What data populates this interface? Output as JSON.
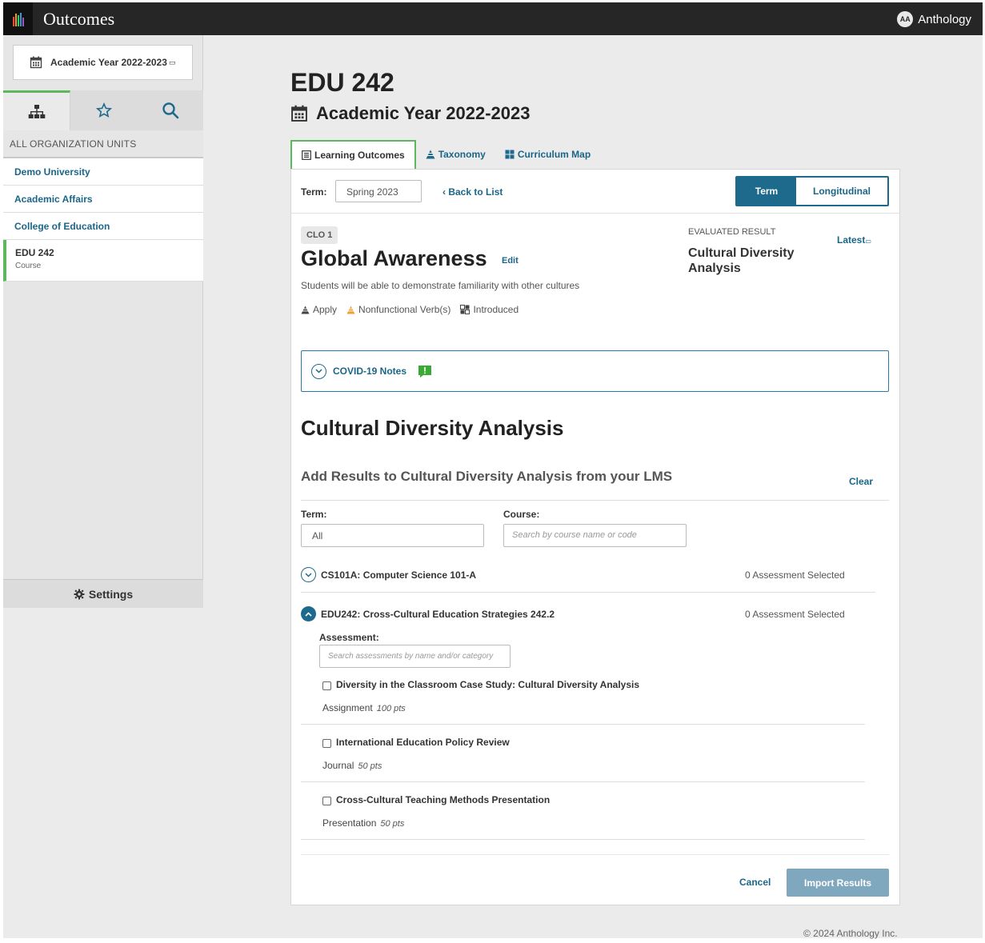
{
  "app": {
    "title": "Outcomes",
    "brand_badge": "AA",
    "brand_name": "Anthology"
  },
  "sidebar": {
    "year_selector": "Academic Year 2022-2023",
    "org_header": "ALL ORGANIZATION UNITS",
    "org_units": [
      {
        "label": "Demo University"
      },
      {
        "label": "Academic Affairs"
      },
      {
        "label": "College of Education"
      }
    ],
    "current_unit": {
      "label": "EDU 242",
      "type": "Course"
    },
    "settings_label": "Settings"
  },
  "page": {
    "title": "EDU 242",
    "subtitle": "Academic Year 2022-2023",
    "tabs": [
      {
        "label": "Learning Outcomes",
        "active": true
      },
      {
        "label": "Taxonomy",
        "active": false
      },
      {
        "label": "Curriculum Map",
        "active": false
      }
    ]
  },
  "term_bar": {
    "label": "Term:",
    "value": "Spring 2023",
    "back_label": "Back to List",
    "view_term": "Term",
    "view_longitudinal": "Longitudinal"
  },
  "outcome": {
    "badge": "CLO 1",
    "title": "Global Awareness",
    "edit_label": "Edit",
    "description": "Students will be able to demonstrate familiarity with other cultures",
    "tags": [
      {
        "label": "Apply",
        "icon": "taxonomy-pyramid-icon",
        "color": "#444444"
      },
      {
        "label": "Nonfunctional Verb(s)",
        "icon": "warning-pyramid-icon",
        "color": "#f0a030"
      },
      {
        "label": "Introduced",
        "icon": "curriculum-grid-icon",
        "color": "#444444"
      }
    ],
    "evaluated_result_header": "EVALUATED RESULT",
    "evaluated_result_name": "Cultural Diversity Analysis",
    "latest_label": "Latest"
  },
  "covid": {
    "label": "COVID-19 Notes",
    "note_icon_color": "#3aaa35"
  },
  "results": {
    "section_title": "Cultural Diversity Analysis",
    "import_title": "Add Results to Cultural Diversity Analysis from your LMS",
    "clear_label": "Clear",
    "term_filter_label": "Term:",
    "term_filter_value": "All",
    "course_filter_label": "Course:",
    "course_filter_placeholder": "Search by course name or code",
    "courses": [
      {
        "name": "CS101A: Computer Science 101-A",
        "count": "0 Assessment Selected",
        "expanded": false
      },
      {
        "name": "EDU242: Cross-Cultural Education Strategies 242.2",
        "count": "0 Assessment Selected",
        "expanded": true
      }
    ],
    "assessment_label": "Assessment:",
    "assessment_placeholder": "Search assessments by name and/or category",
    "assessments": [
      {
        "name": "Diversity in the Classroom Case Study: Cultural Diversity Analysis",
        "type": "Assignment",
        "points": "100 pts",
        "checked": false
      },
      {
        "name": "International Education Policy Review",
        "type": "Journal",
        "points": "50 pts",
        "checked": false
      },
      {
        "name": "Cross-Cultural Teaching Methods Presentation",
        "type": "Presentation",
        "points": "50 pts",
        "checked": false
      }
    ],
    "cancel_label": "Cancel",
    "import_label": "Import Results"
  },
  "footer": {
    "copyright": "© 2024 Anthology Inc."
  },
  "colors": {
    "accent_teal": "#1e6a8c",
    "active_green": "#5cb85c",
    "link_blue": "#1a6688",
    "topbar": "#262626"
  }
}
